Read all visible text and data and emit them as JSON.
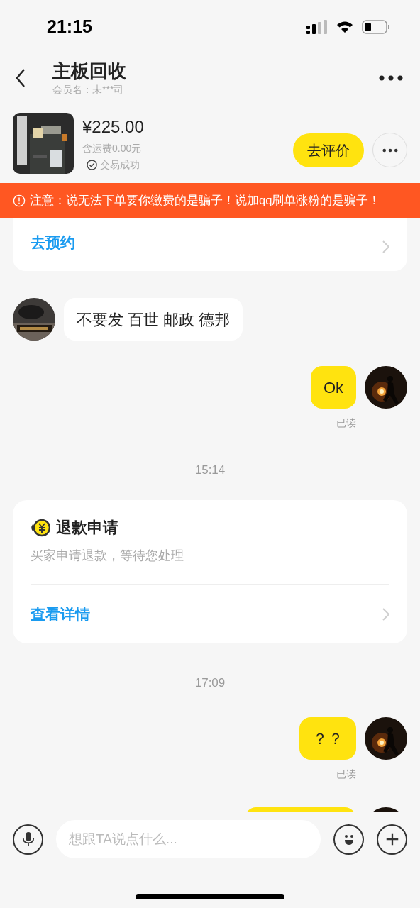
{
  "status_bar": {
    "time": "21:15"
  },
  "header": {
    "title": "主板回收",
    "member": "会员名：未***司"
  },
  "product": {
    "price": "¥225.00",
    "shipping": "含运费0.00元",
    "status": "交易成功",
    "action": "去评价"
  },
  "notice": "注意：说无法下单要你缴费的是骗子！说加qq刷单涨粉的是骗子！",
  "messages": [
    {
      "kind": "link_card",
      "link": "去预约"
    },
    {
      "kind": "incoming",
      "text": "不要发 百世 邮政 德邦"
    },
    {
      "kind": "outgoing",
      "text": "Ok",
      "receipt": "已读"
    },
    {
      "kind": "time",
      "text": "15:14"
    },
    {
      "kind": "refund_card",
      "title": "退款申请",
      "desc": "买家申请退款，等待您处理",
      "link": "查看详情"
    },
    {
      "kind": "time",
      "text": "17:09"
    },
    {
      "kind": "outgoing",
      "text": "？？",
      "receipt": "已读"
    },
    {
      "kind": "outgoing"
    }
  ],
  "input": {
    "placeholder": "想跟TA说点什么..."
  }
}
